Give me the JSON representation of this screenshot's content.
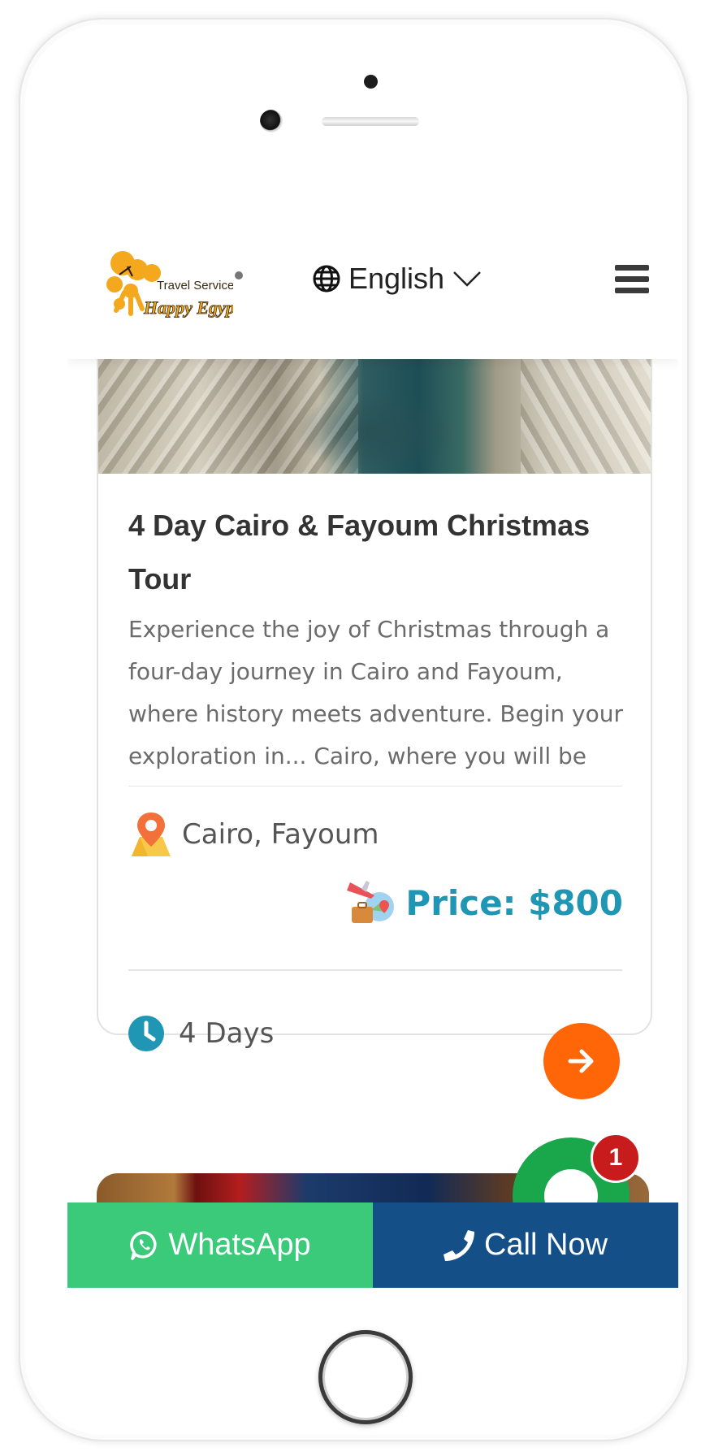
{
  "header": {
    "logo_text_top": "Travel Services",
    "logo_text_bottom": "Happy Egypt",
    "language": "English"
  },
  "tour": {
    "title": "4 Day Cairo & Fayoum Christmas Tour",
    "description": "Experience the joy of Christmas through a four-day journey in Cairo and Fayoum, where history meets adventure. Begin your exploration in... Cairo, where you will be captivated by",
    "location": "Cairo, Fayoum",
    "price": "Price: $800",
    "duration": "4 Days"
  },
  "chat_widget": {
    "badge_count": "1"
  },
  "bottom_bar": {
    "whatsapp_label": "WhatsApp",
    "call_label": "Call Now"
  },
  "colors": {
    "accent_orange": "#ff6608",
    "price_blue": "#1f97b4",
    "whatsapp_green": "#3bc97a",
    "call_blue": "#154f87",
    "badge_red": "#c81b1b"
  },
  "icons": [
    "globe-icon",
    "chevron-down-icon",
    "menu-icon",
    "location-pin-icon",
    "travel-plane-icon",
    "clock-icon",
    "arrow-right-icon",
    "whatsapp-icon",
    "phone-icon"
  ]
}
